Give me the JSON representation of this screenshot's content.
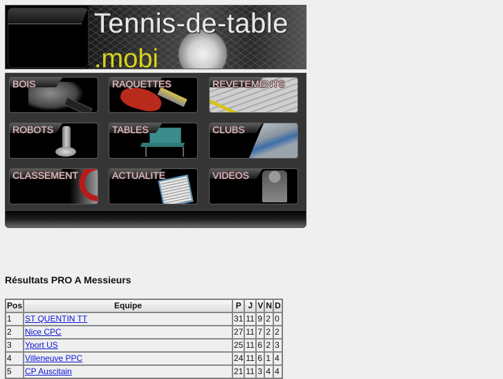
{
  "banner": {
    "title": "Tennis-de-table",
    "suffix": ".mobi"
  },
  "menu": {
    "items": [
      {
        "label": "BOIS",
        "art": "bois"
      },
      {
        "label": "RAQUETTES",
        "art": "raquettes"
      },
      {
        "label": "REVETEMENTS",
        "art": "revetements"
      },
      {
        "label": "ROBOTS",
        "art": "robots"
      },
      {
        "label": "TABLES",
        "art": "tables"
      },
      {
        "label": "CLUBS",
        "art": "clubs"
      },
      {
        "label": "CLASSEMENT",
        "art": "classement"
      },
      {
        "label": "ACTUALITE",
        "art": "actualite"
      },
      {
        "label": "VIDEOS",
        "art": "videos"
      }
    ]
  },
  "results": {
    "title": "Résultats PRO A Messieurs",
    "columns": [
      "Pos",
      "Equipe",
      "P",
      "J",
      "V",
      "N",
      "D"
    ],
    "rows": [
      {
        "pos": "1",
        "team": "ST QUENTIN TT",
        "p": "31",
        "j": "11",
        "v": "9",
        "n": "2",
        "d": "0"
      },
      {
        "pos": "2",
        "team": "Nice CPC",
        "p": "27",
        "j": "11",
        "v": "7",
        "n": "2",
        "d": "2"
      },
      {
        "pos": "3",
        "team": "Yport US",
        "p": "25",
        "j": "11",
        "v": "6",
        "n": "2",
        "d": "3"
      },
      {
        "pos": "4",
        "team": "Villeneuve PPC",
        "p": "24",
        "j": "11",
        "v": "6",
        "n": "1",
        "d": "4"
      },
      {
        "pos": "5",
        "team": "CP Auscitain",
        "p": "21",
        "j": "11",
        "v": "3",
        "n": "4",
        "d": "4"
      }
    ]
  },
  "colors": {
    "background": "#efefef",
    "link": "#0a14d8",
    "mobi": "#d8d41a",
    "tile_label": "#b9e4ea"
  }
}
